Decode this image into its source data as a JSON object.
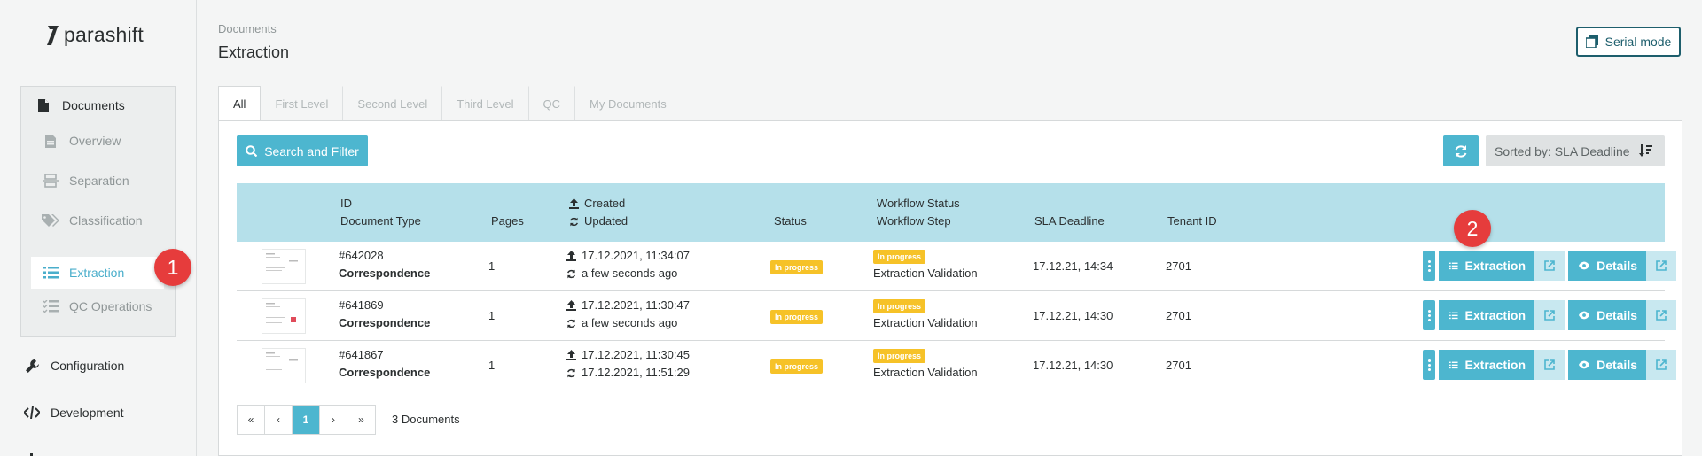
{
  "app": {
    "logo_text": "parashift"
  },
  "sidebar": {
    "documents_label": "Documents",
    "items": [
      {
        "label": "Overview",
        "icon": "file-icon"
      },
      {
        "label": "Separation",
        "icon": "separation-icon"
      },
      {
        "label": "Classification",
        "icon": "tags-icon"
      },
      {
        "label": "Extraction",
        "icon": "list-icon",
        "active": true
      },
      {
        "label": "QC Operations",
        "icon": "checklist-icon"
      }
    ],
    "configuration_label": "Configuration",
    "development_label": "Development"
  },
  "callouts": {
    "one": "1",
    "two": "2",
    "color": "#e63c3c"
  },
  "header": {
    "breadcrumb": "Documents",
    "title": "Extraction",
    "serial_mode_label": "Serial mode"
  },
  "tabs": [
    {
      "label": "All",
      "active": true
    },
    {
      "label": "First Level"
    },
    {
      "label": "Second Level"
    },
    {
      "label": "Third Level"
    },
    {
      "label": "QC"
    },
    {
      "label": "My Documents"
    }
  ],
  "toolbar": {
    "search_label": "Search and Filter",
    "sort_label": "Sorted by: SLA Deadline"
  },
  "table": {
    "headers": {
      "id": "ID",
      "document_type": "Document Type",
      "pages": "Pages",
      "created": "Created",
      "updated": "Updated",
      "status": "Status",
      "workflow_status": "Workflow Status",
      "workflow_step": "Workflow Step",
      "sla_deadline": "SLA Deadline",
      "tenant_id": "Tenant ID"
    },
    "rows": [
      {
        "id": "#642028",
        "type": "Correspondence",
        "pages": "1",
        "created": "17.12.2021, 11:34:07",
        "updated": "a few seconds ago",
        "status": "In progress",
        "workflow_status": "In progress",
        "workflow_step": "Extraction Validation",
        "sla": "17.12.21, 14:34",
        "tenant": "2701",
        "extraction_label": "Extraction",
        "details_label": "Details"
      },
      {
        "id": "#641869",
        "type": "Correspondence",
        "pages": "1",
        "created": "17.12.2021, 11:30:47",
        "updated": "a few seconds ago",
        "status": "In progress",
        "workflow_status": "In progress",
        "workflow_step": "Extraction Validation",
        "sla": "17.12.21, 14:30",
        "tenant": "2701",
        "extraction_label": "Extraction",
        "details_label": "Details"
      },
      {
        "id": "#641867",
        "type": "Correspondence",
        "pages": "1",
        "created": "17.12.2021, 11:30:45",
        "updated": "17.12.2021, 11:51:29",
        "status": "In progress",
        "workflow_status": "In progress",
        "workflow_step": "Extraction Validation",
        "sla": "17.12.21, 14:30",
        "tenant": "2701",
        "extraction_label": "Extraction",
        "details_label": "Details"
      }
    ]
  },
  "pagination": {
    "first": "«",
    "prev": "‹",
    "current": "1",
    "next": "›",
    "last": "»",
    "count_label": "3 Documents"
  },
  "colors": {
    "accent": "#4db6cf",
    "header_row": "#b5e0ea",
    "pill": "#f6c228",
    "serial_border": "#1d5e6c"
  }
}
